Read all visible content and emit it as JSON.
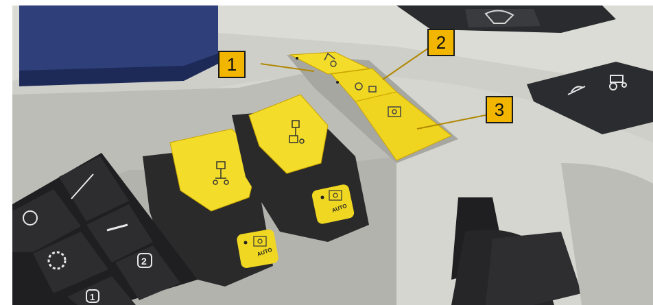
{
  "callouts": [
    {
      "number": "1"
    },
    {
      "number": "2"
    },
    {
      "number": "3"
    }
  ],
  "button_labels": {
    "left_auto": "AUTO",
    "right_auto": "AUTO"
  },
  "keypad": {
    "key_1": "1",
    "key_2": "2"
  },
  "colors": {
    "callout_fill": "#f2b600",
    "switch_yellow": "#f3dc2a",
    "console_grey": "#c9c9c4",
    "keypad_black": "#2b2b2d",
    "leader_line": "#8a6a00"
  },
  "icons": [
    "linkage-up-icon",
    "wheel-icon",
    "tractor-icon",
    "hitch-icon",
    "pto-icon",
    "gear-icon",
    "wiper-icon"
  ]
}
